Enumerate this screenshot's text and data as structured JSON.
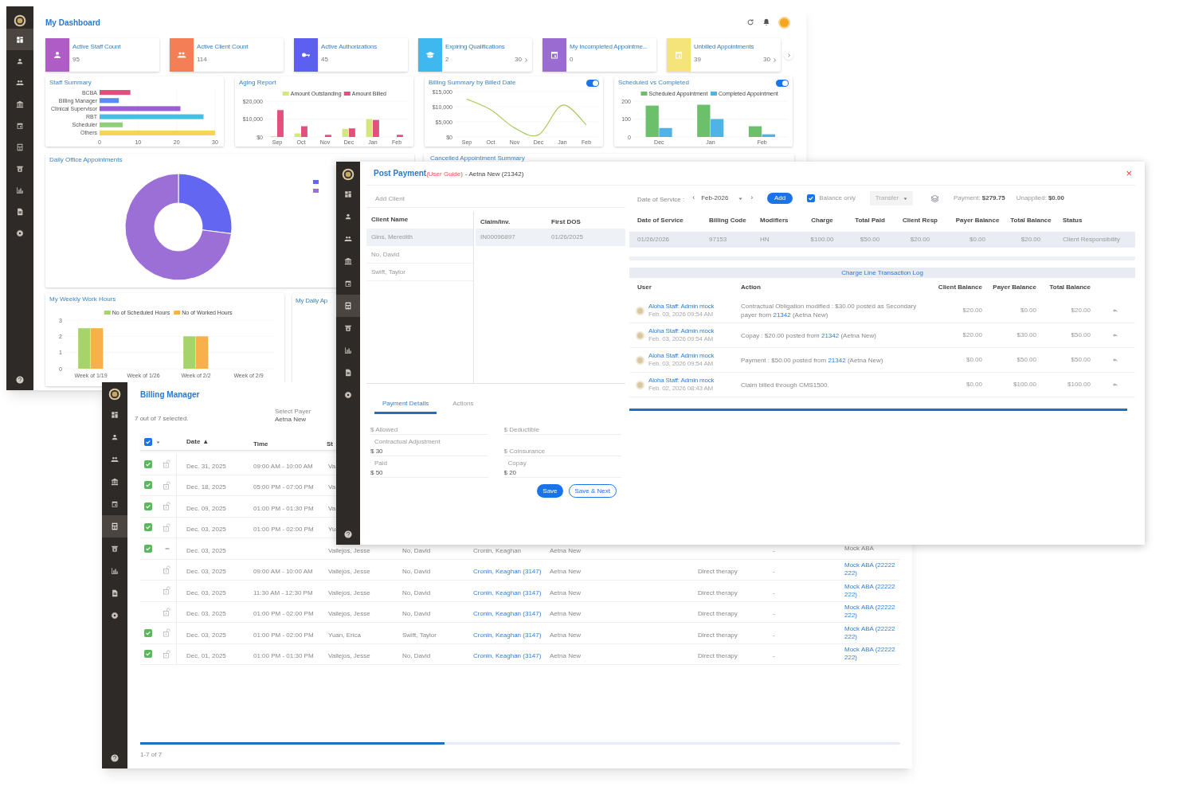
{
  "dashboard": {
    "sidebar": [
      {
        "selected": true
      },
      {
        "selected": false
      },
      {
        "selected": false
      },
      {
        "selected": false
      },
      {
        "selected": false
      },
      {
        "selected": false
      },
      {
        "selected": false
      },
      {
        "selected": false
      },
      {
        "selected": false
      },
      {
        "selected": false
      }
    ],
    "title": "My Dashboard",
    "stat_cards": [
      {
        "title": "Active Staff Count",
        "value": "95",
        "color": "#b05cc7"
      },
      {
        "title": "Active Client Count",
        "value": "114",
        "color": "#f47f56"
      },
      {
        "title": "Active Authorizations",
        "value": "45",
        "color": "#5d5ff0"
      },
      {
        "title": "Expiring Qualifications",
        "value": "2",
        "color": "#3fb8ef",
        "link": "30"
      },
      {
        "title": "My Incompleted Appointme...",
        "value": "0",
        "color": "#9a6bd1"
      },
      {
        "title": "Unbilled Appointments",
        "value": "39",
        "color": "#f5e47a",
        "link": "30"
      }
    ],
    "charts": [
      {
        "title": "Staff Summary",
        "chart_data": {
          "type": "bar",
          "orientation": "horizontal",
          "categories": [
            "BCBA",
            "Billing Manager",
            "Clinical Supervisor",
            "RBT",
            "Scheduler",
            "Others"
          ],
          "xlim": [
            0,
            30
          ],
          "xticks": [
            0,
            10,
            20,
            30
          ],
          "stacked": true,
          "series": [
            {
              "color": "#e0507a",
              "values": [
                8,
                null,
                null,
                null,
                null,
                null
              ]
            },
            {
              "color": "#5b8def",
              "values": [
                null,
                5,
                null,
                null,
                null,
                null
              ]
            },
            {
              "color": "#9a5fd0",
              "values": [
                null,
                null,
                21,
                null,
                null,
                null
              ]
            },
            {
              "color": "#45c0e0",
              "values": [
                null,
                null,
                null,
                27,
                null,
                null
              ]
            },
            {
              "color": "#8fd07a",
              "values": [
                null,
                null,
                null,
                null,
                6,
                null
              ]
            },
            {
              "color": "#f5d45a",
              "values": [
                null,
                null,
                null,
                null,
                null,
                30
              ]
            }
          ]
        }
      },
      {
        "title": "Aging Report",
        "chart_data": {
          "type": "bar",
          "legend": "top",
          "categories": [
            "Sep",
            "Oct",
            "Nov",
            "Dec",
            "Jan",
            "Feb"
          ],
          "ylim": [
            0,
            20000
          ],
          "yticks": [
            {
              "value": 0,
              "label": "$0"
            },
            {
              "value": 10000,
              "label": "$10,000"
            },
            {
              "value": 20000,
              "label": "$20,000"
            }
          ],
          "series": [
            {
              "name": "Amount Outstanding",
              "color": "#d6e57c",
              "values": [
                500,
                2000,
                0,
                4500,
                10000,
                0
              ]
            },
            {
              "name": "Amount Billed",
              "color": "#e2507e",
              "values": [
                15000,
                6000,
                1200,
                4800,
                9500,
                1200
              ]
            }
          ]
        }
      },
      {
        "title": "Billing Summary by Billed Date",
        "toggle_on": true,
        "chart_data": {
          "type": "line",
          "categories": [
            "Sep",
            "Oct",
            "Nov",
            "Dec",
            "Jan",
            "Feb"
          ],
          "ylim": [
            0,
            15000
          ],
          "yticks": [
            {
              "value": 0,
              "label": "$0"
            },
            {
              "value": 5000,
              "label": "$5,000"
            },
            {
              "value": 10000,
              "label": "$10,000"
            },
            {
              "value": 15000,
              "label": "$15,000"
            }
          ],
          "series": [
            {
              "color": "#a8c85c",
              "values": [
                12500,
                9000,
                3000,
                700,
                10500,
                4000
              ]
            }
          ]
        }
      },
      {
        "title": "Scheduled vs Completed",
        "toggle_on": true,
        "chart_data": {
          "type": "bar",
          "legend": "top",
          "categories": [
            "Dec",
            "Jan",
            "Feb"
          ],
          "ylim": [
            0,
            200
          ],
          "yticks": [
            0,
            100,
            200
          ],
          "series": [
            {
              "name": "Scheduled Appointment",
              "color": "#6cc06c",
              "values": [
                175,
                180,
                60
              ]
            },
            {
              "name": "Completed Appointment",
              "color": "#4fb3e8",
              "values": [
                50,
                100,
                15
              ]
            }
          ]
        }
      }
    ],
    "daily_office": {
      "title": "Daily Office Appointments"
    },
    "cancelled": {
      "title": "Cancelled Appointment Summary"
    },
    "weekly": {
      "title": "My Weekly Work Hours",
      "chart_data": {
        "type": "bar",
        "legend": "top",
        "categories": [
          "Week of 1/19",
          "Week of 1/26",
          "Week of 2/2",
          "Week of 2/9"
        ],
        "ylim": [
          0,
          3
        ],
        "yticks": [
          0,
          1,
          2,
          3
        ],
        "series": [
          {
            "name": "No of Scheduled Hours",
            "color": "#a6d36a",
            "values": [
              2.5,
              null,
              2,
              null
            ]
          },
          {
            "name": "No of Worked Hours",
            "color": "#f8b04a",
            "values": [
              2.5,
              null,
              2,
              null
            ]
          }
        ]
      }
    },
    "daily_appointments": {
      "title": "My Daily Ap"
    }
  },
  "billing_manager": {
    "sidebar": [
      {
        "selected": false
      },
      {
        "selected": false
      },
      {
        "selected": false
      },
      {
        "selected": false
      },
      {
        "selected": false
      },
      {
        "selected": true
      },
      {
        "selected": false
      },
      {
        "selected": false
      },
      {
        "selected": false
      },
      {
        "selected": false
      }
    ],
    "title": "Billing Manager",
    "selection": "7 out of 7 selected.",
    "payer_label": "Select Payer",
    "payer": "Aetna New",
    "header": {
      "select_all": true,
      "date": "Date",
      "sort": "▲",
      "time": "Time",
      "staff": "St"
    },
    "rows": [
      {
        "checked": true,
        "kind": "lock",
        "date": "Dec. 31, 2025",
        "time": "09:00 AM - 10:00 AM",
        "staff": "Va"
      },
      {
        "checked": true,
        "kind": "lock",
        "date": "Dec. 18, 2025",
        "time": "05:00 PM - 07:00 PM",
        "staff": "Va"
      },
      {
        "checked": true,
        "kind": "lock",
        "date": "Dec. 09, 2025",
        "time": "01:00 PM - 01:30 PM",
        "staff": "Va"
      },
      {
        "checked": true,
        "kind": "lock",
        "date": "Dec. 03, 2025",
        "time": "01:00 PM - 02:00 PM",
        "staff": "Yu"
      },
      {
        "checked": true,
        "kind": "group",
        "date": "Dec. 03, 2025",
        "staff": "Vallejos, Jesse",
        "client": "No, David",
        "provider": "Cronin, Keaghan",
        "payer": "Aetna New",
        "dash": "-",
        "location": "Mock ABA"
      },
      {
        "checked": false,
        "kind": "lock",
        "date": "Dec. 03, 2025",
        "time": "09:00 AM - 10:00 AM",
        "staff": "Vallejos, Jesse",
        "client": "No, David",
        "provider": "Cronin, Keaghan (3147)",
        "payer": "Aetna New",
        "service": "Direct therapy",
        "dash": "-",
        "location": "Mock ABA (22222222)"
      },
      {
        "checked": false,
        "kind": "lock",
        "date": "Dec. 03, 2025",
        "time": "11:30 AM - 12:30 PM",
        "staff": "Vallejos, Jesse",
        "client": "No, David",
        "provider": "Cronin, Keaghan (3147)",
        "payer": "Aetna New",
        "service": "Direct therapy",
        "dash": "-",
        "location": "Mock ABA (22222222)"
      },
      {
        "checked": false,
        "kind": "lock",
        "date": "Dec. 03, 2025",
        "time": "01:00 PM - 02:00 PM",
        "staff": "Vallejos, Jesse",
        "client": "No, David",
        "provider": "Cronin, Keaghan (3147)",
        "payer": "Aetna New",
        "service": "Direct therapy",
        "dash": "-",
        "location": "Mock ABA (22222222)"
      },
      {
        "checked": true,
        "kind": "lock",
        "date": "Dec. 03, 2025",
        "time": "01:00 PM - 02:00 PM",
        "staff": "Yuan, Erica",
        "client": "Swift, Taylor",
        "provider": "Cronin, Keaghan (3147)",
        "payer": "Aetna New",
        "service": "Direct therapy",
        "dash": "-",
        "location": "Mock ABA (22222222)"
      },
      {
        "checked": true,
        "kind": "lock",
        "date": "Dec. 01, 2025",
        "time": "01:00 PM - 01:30 PM",
        "staff": "Vallejos, Jesse",
        "client": "No, David",
        "provider": "Cronin, Keaghan (3147)",
        "payer": "Aetna New",
        "service": "Direct therapy",
        "dash": "-",
        "location": "Mock ABA (22222222)"
      }
    ],
    "pagination": "1-7 of 7"
  },
  "post_payment": {
    "sidebar": [
      {
        "selected": false
      },
      {
        "selected": false
      },
      {
        "selected": false
      },
      {
        "selected": false
      },
      {
        "selected": false
      },
      {
        "selected": true
      },
      {
        "selected": false
      },
      {
        "selected": false
      },
      {
        "selected": false
      },
      {
        "selected": false
      }
    ],
    "title": "Post Payment",
    "guide": "(User Guide)",
    "subtitle": "- Aetna New (21342)",
    "close": "×",
    "add_client": {
      "placeholder": "Add Client"
    },
    "clients": {
      "header": "Client Name",
      "rows": [
        {
          "name": "Gins, Meredith",
          "selected": true
        },
        {
          "name": "No, David",
          "selected": false
        },
        {
          "name": "Swift, Taylor",
          "selected": false
        }
      ]
    },
    "claims": {
      "columns": [
        "Claim/Inv.",
        "First DOS"
      ],
      "rows": [
        {
          "cells": [
            "IN00096897",
            "01/26/2025"
          ],
          "selected": true
        }
      ]
    },
    "tabs": [
      {
        "label": "Payment Details",
        "selected": true
      },
      {
        "label": "Actions",
        "selected": false
      }
    ],
    "fields": [
      {
        "placeholder": "$ Allowed"
      },
      {
        "placeholder": "$ Deductible"
      },
      {
        "label": "Contractual Adjustment",
        "value": "$ 30"
      },
      {
        "placeholder": "$ Coinsurance"
      },
      {
        "label": "Paid",
        "value": "$ 50"
      },
      {
        "label": "Copay",
        "value": "$ 20"
      }
    ],
    "buttons": [
      {
        "label": "Save",
        "kind": "primary"
      },
      {
        "label": "Save & Next",
        "kind": "outline"
      }
    ],
    "toolbar": {
      "dos_label": "Date of Service :",
      "prev": "‹",
      "month": "Feb-2026",
      "next": "›",
      "add": "Add",
      "balance_only": {
        "label": "Balance only",
        "checked": true
      },
      "transfer": {
        "label": "Transfer",
        "disabled": true
      },
      "payment_label": "Payment:",
      "payment": "$279.75",
      "unapplied_label": "Unapplied:",
      "unapplied": "$0.00"
    },
    "charges": {
      "columns": [
        "Date of Service",
        "Billing Code",
        "Modifiers",
        "Charge",
        "Total Paid",
        "Client Resp",
        "Payer Balance",
        "Total Balance",
        "Status"
      ],
      "rows": [
        {
          "cells": [
            "01/26/2026",
            "97153",
            "HN",
            "$100.00",
            "$50.00",
            "$20.00",
            "$0.00",
            "$20.00",
            "Client Responsibility"
          ],
          "selected": true
        }
      ]
    },
    "log": {
      "title": "Charge Line Transaction Log",
      "columns": [
        "User",
        "Action",
        "Client Balance",
        "Payer Balance",
        "Total Balance"
      ],
      "rows": [
        {
          "user": "Aloha Staff: Admin mock",
          "time": "Feb. 03, 2026 09:54 AM",
          "action": {
            "before": "Contractual Obligation modified : $30.00 posted as Secondary payer from ",
            "link": "21342",
            "after": " (Aetna New)"
          },
          "client_balance": "$20.00",
          "payer_balance": "$0.00",
          "total_balance": "$20.00"
        },
        {
          "user": "Aloha Staff: Admin mock",
          "time": "Feb. 03, 2026 09:54 AM",
          "action": {
            "before": "Copay : $20.00 posted from ",
            "link": "21342",
            "after": " (Aetna New)"
          },
          "client_balance": "$20.00",
          "payer_balance": "$30.00",
          "total_balance": "$50.00"
        },
        {
          "user": "Aloha Staff: Admin mock",
          "time": "Feb. 03, 2026 09:54 AM",
          "action": {
            "before": "Payment : $50.00 posted from ",
            "link": "21342",
            "after": " (Aetna New)"
          },
          "client_balance": "$0.00",
          "payer_balance": "$50.00",
          "total_balance": "$50.00"
        },
        {
          "user": "Aloha Staff: Admin mock",
          "time": "Feb. 02, 2026 08:43 AM",
          "action": {
            "before": "Claim billed through CMS1500."
          },
          "client_balance": "$0.00",
          "payer_balance": "$100.00",
          "total_balance": "$100.00"
        }
      ]
    }
  }
}
